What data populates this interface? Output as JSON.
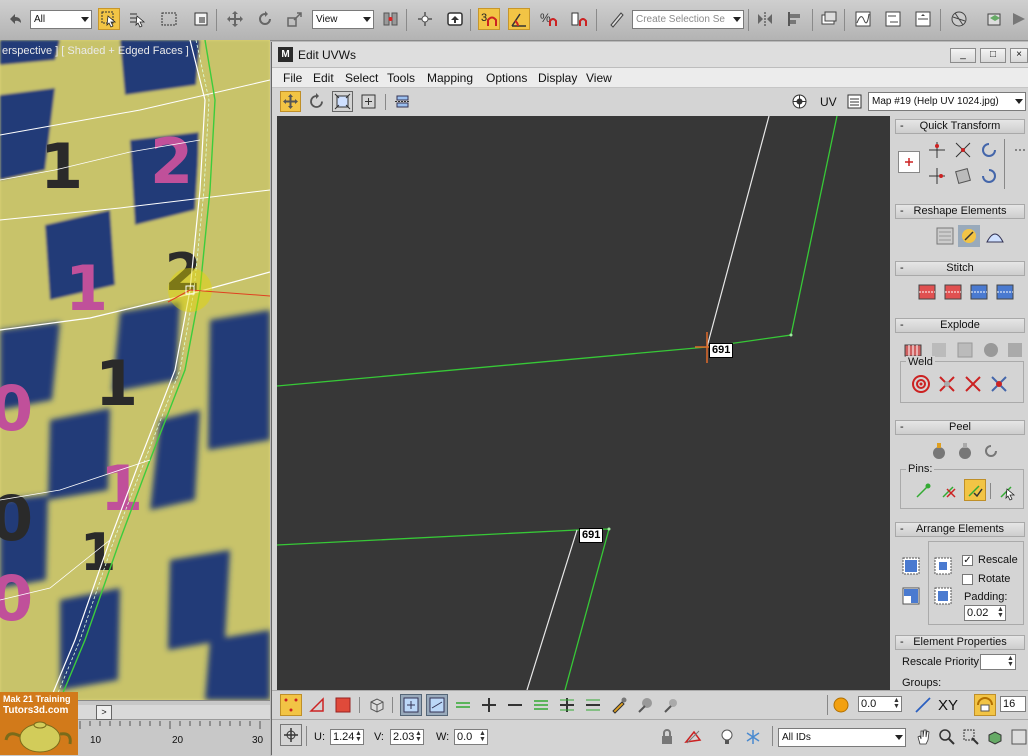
{
  "toolbar": {
    "selection_filter": "All",
    "ref_coord": "View",
    "snap_label": "3",
    "named_selection_placeholder": "Create Selection Se",
    "icons": [
      "undo-icon",
      "select-object-icon",
      "select-by-name-icon",
      "rect-region-icon",
      "window-crossing-icon",
      "move-icon",
      "rotate-icon",
      "scale-icon",
      "pivot-icon",
      "select-manipulate-icon",
      "keyboard-shortcut-icon",
      "snaps-toggle-icon",
      "angle-snap-icon",
      "percent-snap-icon",
      "spinner-snap-icon",
      "edit-named-selection-icon",
      "mirror-icon",
      "align-icon",
      "layer-manager-icon",
      "curve-editor-icon",
      "schematic-view-icon",
      "material-editor-icon",
      "render-setup-icon",
      "rendered-frame-icon",
      "render-icon"
    ]
  },
  "viewport": {
    "label": "erspective ] [ Shaded + Edged Faces ]",
    "checker_digits": [
      "1",
      "2",
      "1",
      "2",
      "1",
      "0",
      "1",
      "0",
      "0",
      "1"
    ]
  },
  "timeline": {
    "ticks": [
      "10",
      "20",
      "30"
    ],
    "logo_line1": "Mak 21 Training",
    "logo_line2": "Tutors3d.com"
  },
  "uvw": {
    "title": "Edit UVWs",
    "window_buttons": [
      "_",
      "□",
      "×"
    ],
    "menu": [
      "File",
      "Edit",
      "Select",
      "Tools",
      "Mapping",
      "Options",
      "Display",
      "View"
    ],
    "uv_label": "UV",
    "map_dropdown": "Map #19 (Help UV 1024.jpg)",
    "vertex_labels": [
      "691",
      "691"
    ]
  },
  "rollouts": {
    "quick_transform": "Quick Transform",
    "reshape": "Reshape Elements",
    "stitch": "Stitch",
    "explode": "Explode",
    "weld": "Weld",
    "peel": "Peel",
    "pins": "Pins:",
    "arrange": "Arrange Elements",
    "rescale_label": "Rescale",
    "rescale_checked": true,
    "rotate_label": "Rotate",
    "rotate_checked": false,
    "padding_label": "Padding:",
    "padding_value": "0.02",
    "element_props": "Element Properties",
    "rescale_priority": "Rescale Priority:",
    "groups": "Groups:"
  },
  "bottom": {
    "spin_value": "0.0",
    "xy_label": "XY",
    "grid_value": "16",
    "u_label": "U:",
    "u_value": "1.24",
    "v_label": "V:",
    "v_value": "2.03",
    "w_label": "W:",
    "w_value": "0.0",
    "ids_dropdown": "All IDs"
  },
  "colors": {
    "accent": "#f2c445",
    "uv_edge_green": "#37c837",
    "uv_edge_white": "#e8e8e8",
    "canvas_bg": "#373737",
    "checker_yellow": "#d8d26a",
    "checker_blue": "#233a78"
  }
}
